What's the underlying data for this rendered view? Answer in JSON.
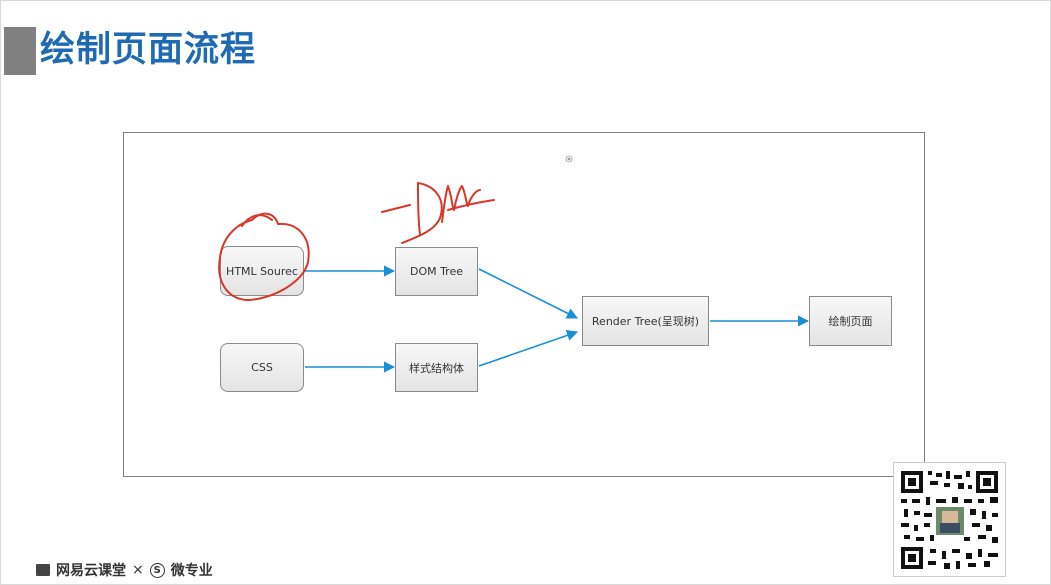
{
  "slide": {
    "title": "绘制页面流程"
  },
  "diagram": {
    "nodes": [
      {
        "id": "html",
        "label": "HTML Sourec",
        "style": "rounded"
      },
      {
        "id": "css",
        "label": "CSS",
        "style": "rounded"
      },
      {
        "id": "dom",
        "label": "DOM Tree",
        "style": "square"
      },
      {
        "id": "style",
        "label": "样式结构体",
        "style": "square"
      },
      {
        "id": "render",
        "label": "Render Tree(呈现树)",
        "style": "square"
      },
      {
        "id": "paint",
        "label": "绘制页面",
        "style": "square"
      }
    ],
    "edges": [
      {
        "from": "html",
        "to": "dom"
      },
      {
        "from": "css",
        "to": "style"
      },
      {
        "from": "dom",
        "to": "render"
      },
      {
        "from": "style",
        "to": "render"
      },
      {
        "from": "render",
        "to": "paint"
      }
    ],
    "arrow_color": "#1a8fd6",
    "annotation_color": "#d9372a",
    "annotation_text": "-Dm"
  },
  "footer": {
    "brand": "网易云课堂",
    "separator": "×",
    "partner_icon": "S",
    "partner": "微专业"
  },
  "icons": {
    "qr": "qr-code-icon",
    "center_marker": "target-icon"
  }
}
